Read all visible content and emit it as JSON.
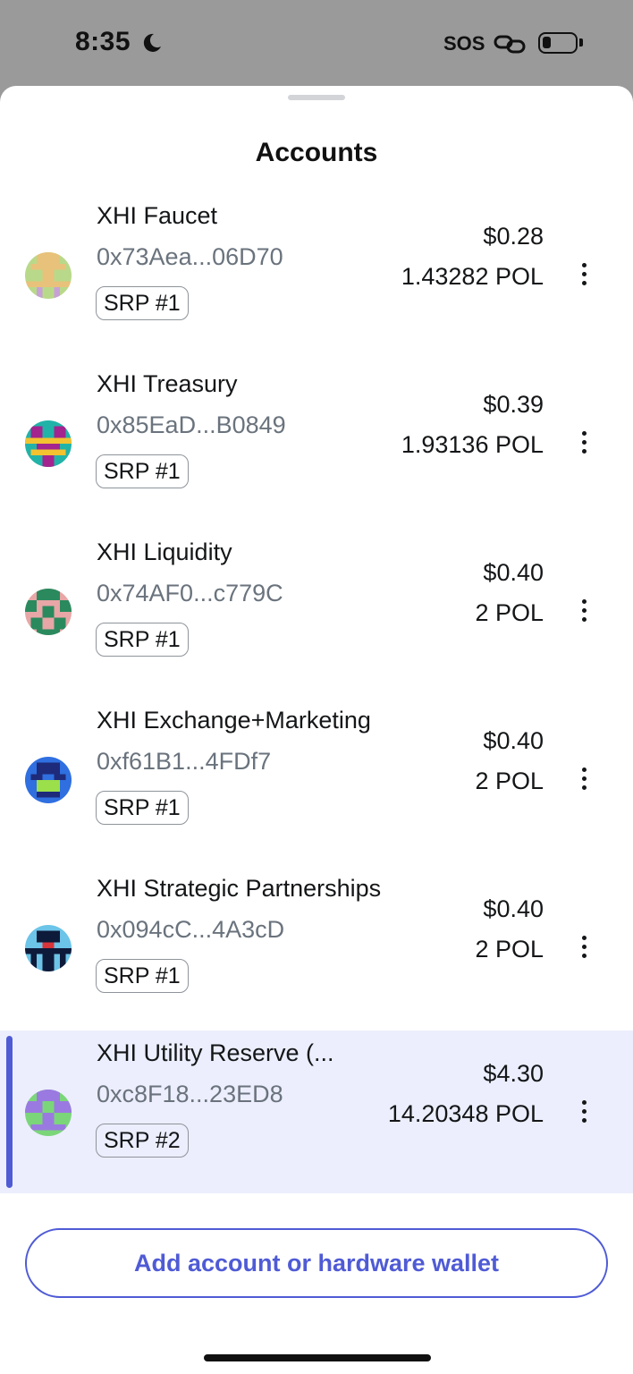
{
  "status_bar": {
    "time": "8:35",
    "sos_label": "SOS",
    "icons": [
      "moon-icon",
      "link-icon",
      "battery-icon"
    ]
  },
  "sheet": {
    "title": "Accounts",
    "add_button_label": "Add account or hardware wallet"
  },
  "accounts": [
    {
      "name": "XHI Faucet",
      "address": "0x73Aea...06D70",
      "srp": "SRP #1",
      "fiat": "$0.28",
      "crypto": "1.43282 POL",
      "selected": false
    },
    {
      "name": "XHI Treasury",
      "address": "0x85EaD...B0849",
      "srp": "SRP #1",
      "fiat": "$0.39",
      "crypto": "1.93136 POL",
      "selected": false
    },
    {
      "name": "XHI Liquidity",
      "address": "0x74AF0...c779C",
      "srp": "SRP #1",
      "fiat": "$0.40",
      "crypto": "2 POL",
      "selected": false
    },
    {
      "name": "XHI Exchange+Marketing",
      "address": "0xf61B1...4FDf7",
      "srp": "SRP #1",
      "fiat": "$0.40",
      "crypto": "2 POL",
      "selected": false
    },
    {
      "name": "XHI Strategic Partnerships",
      "address": "0x094cC...4A3cD",
      "srp": "SRP #1",
      "fiat": "$0.40",
      "crypto": "2 POL",
      "selected": false
    },
    {
      "name": "XHI Utility Reserve (...",
      "address": "0xc8F18...23ED8",
      "srp": "SRP #2",
      "fiat": "$4.30",
      "crypto": "14.20348 POL",
      "selected": true
    }
  ],
  "colors": {
    "accent": "#4f5bd5",
    "selected_bg": "#eceefd",
    "address_text": "#6a737d"
  }
}
